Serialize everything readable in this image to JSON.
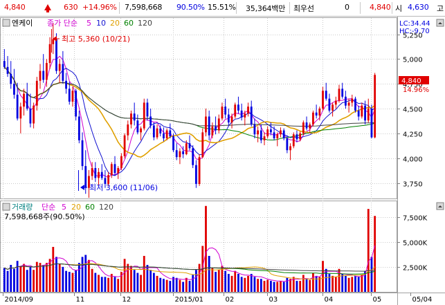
{
  "quote_bar": {
    "price": "4,840",
    "change": "630",
    "change_pct": "+14.96%",
    "volume": "7,598,668",
    "volume_ratio": "90.50%",
    "turnover": "15.51%",
    "amount": "35,364백만",
    "priority_label": "최우선",
    "priority_value": "0",
    "ask": "4,840",
    "open_label": "시",
    "open_value": "4,630",
    "high_label": "고"
  },
  "price_panel": {
    "name": "엔케이",
    "indicator_label": "종가 단순",
    "ma_periods": [
      "5",
      "10",
      "20",
      "60",
      "120"
    ],
    "lc": "LC:34.44",
    "hc": "HC:-9.70",
    "last_price": "4,840",
    "last_pct": "14.96%",
    "high_note": "최고 5,360 (10/21)",
    "low_note": "최저 3,600 (11/06)",
    "y_ticks": [
      "5,250",
      "5,000",
      "4,750",
      "4,500",
      "4,250",
      "4,000",
      "3,750"
    ]
  },
  "volume_panel": {
    "name": "거래량",
    "indicator_label": "단순",
    "ma_periods": [
      "5",
      "20",
      "60",
      "120"
    ],
    "current": "7,598,668주(90.50%)",
    "y_ticks": [
      "7,500K",
      "5,000K",
      "2,500K"
    ]
  },
  "x_axis": [
    "2014/09",
    "11",
    "12",
    "2015/01",
    "02",
    "03",
    "04",
    "05",
    "05/04"
  ],
  "colors": {
    "up": "#e00000",
    "down": "#0000e0",
    "ma5": "#d000d0",
    "ma10": "#1010d0",
    "ma20": "#e0a000",
    "ma60": "#008000",
    "ma120": "#404040",
    "grid": "#c8c8c8"
  },
  "chart_data": {
    "type": "candlestick",
    "price_ylim": [
      3600,
      5400
    ],
    "volume_ylim": [
      0,
      9000000
    ],
    "candles_ohlcv": [
      [
        4980,
        5100,
        4900,
        4920,
        2400000
      ],
      [
        4920,
        5030,
        4820,
        4850,
        2100000
      ],
      [
        4850,
        4980,
        4700,
        4750,
        2700000
      ],
      [
        4750,
        4900,
        4600,
        4640,
        2300000
      ],
      [
        4640,
        4760,
        4380,
        4400,
        3100000
      ],
      [
        4400,
        4560,
        4250,
        4520,
        2600000
      ],
      [
        4520,
        4700,
        4430,
        4650,
        2800000
      ],
      [
        4650,
        4760,
        4480,
        4500,
        2200000
      ],
      [
        4500,
        4650,
        4310,
        4350,
        2500000
      ],
      [
        4350,
        4560,
        4300,
        4530,
        2200000
      ],
      [
        4530,
        4820,
        4480,
        4780,
        3000000
      ],
      [
        4780,
        4950,
        4700,
        4880,
        2900000
      ],
      [
        4880,
        5050,
        4760,
        4790,
        2700000
      ],
      [
        4790,
        5000,
        4720,
        4960,
        2900000
      ],
      [
        4960,
        5220,
        4900,
        5150,
        3300000
      ],
      [
        5150,
        5360,
        5050,
        5200,
        4500000
      ],
      [
        5200,
        5260,
        4850,
        4880,
        3500000
      ],
      [
        4880,
        5000,
        4760,
        4950,
        2800000
      ],
      [
        4950,
        5080,
        4750,
        4780,
        2500000
      ],
      [
        4780,
        4860,
        4650,
        4700,
        2100000
      ],
      [
        4700,
        4770,
        4540,
        4570,
        2000000
      ],
      [
        4570,
        4720,
        4520,
        4680,
        1900000
      ],
      [
        4680,
        4700,
        4380,
        4420,
        2200000
      ],
      [
        4420,
        4480,
        4150,
        4180,
        2900000
      ],
      [
        4180,
        4260,
        3880,
        3920,
        3500000
      ],
      [
        3920,
        4080,
        3640,
        3700,
        3700000
      ],
      [
        3700,
        3880,
        3600,
        3820,
        3200000
      ],
      [
        3820,
        3960,
        3780,
        3900,
        2300000
      ],
      [
        3900,
        3960,
        3760,
        3800,
        1900000
      ],
      [
        3800,
        3900,
        3720,
        3860,
        1700000
      ],
      [
        3860,
        3940,
        3780,
        3800,
        1500000
      ],
      [
        3800,
        3880,
        3700,
        3740,
        1500000
      ],
      [
        3740,
        3860,
        3720,
        3830,
        1400000
      ],
      [
        3830,
        3960,
        3800,
        3940,
        1800000
      ],
      [
        3940,
        4020,
        3820,
        3850,
        1500000
      ],
      [
        3850,
        3920,
        3790,
        3900,
        1300000
      ],
      [
        3900,
        4050,
        3880,
        4020,
        2000000
      ],
      [
        4020,
        4250,
        4000,
        4230,
        3300000
      ],
      [
        4230,
        4380,
        4180,
        4340,
        2800000
      ],
      [
        4340,
        4480,
        4300,
        4450,
        2600000
      ],
      [
        4450,
        4560,
        4330,
        4380,
        2200000
      ],
      [
        4380,
        4440,
        4240,
        4260,
        1900000
      ],
      [
        4260,
        4320,
        4180,
        4300,
        1700000
      ],
      [
        4300,
        4600,
        4280,
        4560,
        3600000
      ],
      [
        4560,
        4600,
        4380,
        4420,
        2700000
      ],
      [
        4420,
        4500,
        4300,
        4330,
        2200000
      ],
      [
        4330,
        4360,
        4180,
        4210,
        1900000
      ],
      [
        4210,
        4340,
        4190,
        4300,
        1600000
      ],
      [
        4300,
        4330,
        4220,
        4250,
        1400000
      ],
      [
        4250,
        4310,
        4170,
        4200,
        1300000
      ],
      [
        4200,
        4300,
        4180,
        4280,
        1200000
      ],
      [
        4280,
        4350,
        4200,
        4220,
        1100000
      ],
      [
        4220,
        4250,
        4060,
        4080,
        1500000
      ],
      [
        4080,
        4150,
        3980,
        4010,
        1400000
      ],
      [
        4010,
        4100,
        3940,
        4070,
        1200000
      ],
      [
        4070,
        4120,
        4000,
        4040,
        1000000
      ],
      [
        4040,
        4180,
        4030,
        4150,
        1400000
      ],
      [
        4150,
        4230,
        4080,
        4100,
        1100000
      ],
      [
        4100,
        4130,
        3900,
        3930,
        1700000
      ],
      [
        3930,
        3980,
        3700,
        3740,
        2200000
      ],
      [
        3740,
        4040,
        3720,
        4010,
        2800000
      ],
      [
        4010,
        4300,
        4000,
        4260,
        4600000
      ],
      [
        4260,
        4500,
        4220,
        4420,
        8600000
      ],
      [
        4420,
        4480,
        4180,
        4230,
        3600000
      ],
      [
        4230,
        4360,
        4200,
        4320,
        2400000
      ],
      [
        4320,
        4420,
        4240,
        4280,
        2000000
      ],
      [
        4280,
        4440,
        4250,
        4400,
        2200000
      ],
      [
        4400,
        4560,
        4380,
        4520,
        2600000
      ],
      [
        4520,
        4600,
        4400,
        4440,
        2100000
      ],
      [
        4440,
        4500,
        4330,
        4360,
        1800000
      ],
      [
        4360,
        4450,
        4300,
        4420,
        1600000
      ],
      [
        4420,
        4560,
        4400,
        4540,
        2100000
      ],
      [
        4540,
        4620,
        4450,
        4480,
        1800000
      ],
      [
        4480,
        4550,
        4380,
        4410,
        1500000
      ],
      [
        4410,
        4480,
        4330,
        4450,
        1400000
      ],
      [
        4450,
        4560,
        4420,
        4520,
        1600000
      ],
      [
        4520,
        4580,
        4320,
        4340,
        1800000
      ],
      [
        4340,
        4400,
        4200,
        4240,
        1500000
      ],
      [
        4240,
        4320,
        4160,
        4280,
        1300000
      ],
      [
        4280,
        4340,
        4150,
        4180,
        1300000
      ],
      [
        4180,
        4260,
        4130,
        4220,
        1100000
      ],
      [
        4220,
        4320,
        4200,
        4290,
        1200000
      ],
      [
        4290,
        4360,
        4230,
        4260,
        1100000
      ],
      [
        4260,
        4320,
        4180,
        4200,
        1000000
      ],
      [
        4200,
        4260,
        4120,
        4240,
        1000000
      ],
      [
        4240,
        4310,
        4210,
        4280,
        1100000
      ],
      [
        4280,
        4300,
        4180,
        4200,
        1000000
      ],
      [
        4200,
        4230,
        4050,
        4080,
        1400000
      ],
      [
        4080,
        4150,
        3980,
        4120,
        1300000
      ],
      [
        4120,
        4260,
        4100,
        4240,
        1500000
      ],
      [
        4240,
        4280,
        4160,
        4190,
        1100000
      ],
      [
        4190,
        4270,
        4170,
        4250,
        1100000
      ],
      [
        4250,
        4380,
        4230,
        4360,
        1700000
      ],
      [
        4360,
        4420,
        4280,
        4300,
        1300000
      ],
      [
        4300,
        4360,
        4250,
        4340,
        1200000
      ],
      [
        4340,
        4480,
        4320,
        4460,
        1900000
      ],
      [
        4460,
        4540,
        4400,
        4430,
        1600000
      ],
      [
        4430,
        4520,
        4380,
        4500,
        1500000
      ],
      [
        4500,
        4720,
        4480,
        4680,
        3100000
      ],
      [
        4680,
        4760,
        4580,
        4600,
        2300000
      ],
      [
        4600,
        4650,
        4460,
        4480,
        1800000
      ],
      [
        4480,
        4560,
        4420,
        4540,
        1600000
      ],
      [
        4540,
        4620,
        4500,
        4580,
        1500000
      ],
      [
        4580,
        4740,
        4560,
        4700,
        2300000
      ],
      [
        4700,
        4760,
        4600,
        4620,
        1800000
      ],
      [
        4620,
        4680,
        4500,
        4530,
        1600000
      ],
      [
        4530,
        4600,
        4460,
        4560,
        1400000
      ],
      [
        4560,
        4640,
        4520,
        4600,
        1500000
      ],
      [
        4600,
        4620,
        4460,
        4480,
        1600000
      ],
      [
        4480,
        4530,
        4380,
        4420,
        1500000
      ],
      [
        4420,
        4560,
        4400,
        4530,
        1700000
      ],
      [
        4530,
        4580,
        4340,
        4380,
        2100000
      ],
      [
        4380,
        4600,
        4360,
        4500,
        8300000
      ],
      [
        4500,
        4540,
        4200,
        4210,
        3500000
      ],
      [
        4210,
        4860,
        4200,
        4840,
        7600000
      ]
    ],
    "price_levels_labeled": {
      "high": 5360,
      "low": 3600,
      "last": 4840
    }
  }
}
